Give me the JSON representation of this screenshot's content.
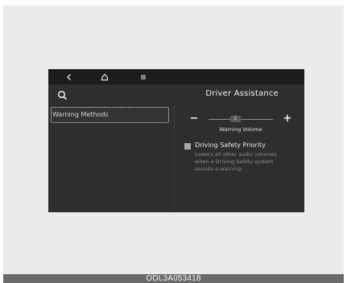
{
  "nav": {
    "back_icon": "back-chevron-icon",
    "home_icon": "home-icon",
    "menu_icon": "menu-icon"
  },
  "header": {
    "search_icon": "search-icon",
    "title": "Driver Assistance"
  },
  "left_menu": {
    "items": [
      {
        "label": "Warning Methods",
        "selected": true
      }
    ]
  },
  "volume": {
    "minus_label": "−",
    "plus_label": "+",
    "value": "2",
    "level_fraction": 0.4,
    "label": "Warning Volume"
  },
  "option": {
    "checked": true,
    "label": "Driving Safety Priority",
    "description": "Lowers all other audio volumes when a Driving Safety system sounds a warning."
  },
  "caption": {
    "code": "ODL3A053418"
  },
  "colors": {
    "screen_bg": "#2e2e2e",
    "topbar_bg": "#1c1c1c",
    "frame_bg": "#ebebeb",
    "caption_bg": "#6a6a6a"
  }
}
